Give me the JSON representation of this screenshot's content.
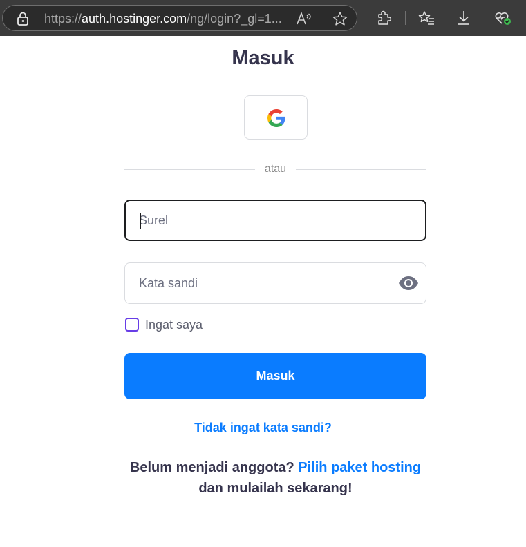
{
  "browser": {
    "url_scheme": "https://",
    "url_host": "auth.hostinger.com",
    "url_path": "/ng/login?_gl=1...",
    "toolbar_icons": [
      "lock-icon",
      "read-aloud-icon",
      "favorite-star-icon",
      "extensions-icon",
      "favorites-icon",
      "download-icon",
      "browser-essentials-icon"
    ]
  },
  "login": {
    "title": "Masuk",
    "google_icon": "google-icon",
    "divider_text": "atau",
    "email_placeholder": "Surel",
    "email_value": "",
    "password_placeholder": "Kata sandi",
    "password_value": "",
    "password_toggle_icon": "eye-icon",
    "remember_label": "Ingat saya",
    "remember_checked": false,
    "submit_label": "Masuk",
    "forgot_label": "Tidak ingat kata sandi?",
    "signup_prefix": "Belum menjadi anggota?",
    "signup_link": "Pilih paket hosting",
    "signup_suffix": "dan mulailah sekarang!"
  },
  "colors": {
    "accent": "#0a7cff",
    "heading": "#36344d",
    "checkbox_border": "#673de6",
    "chrome_bg": "#3b3b3b"
  }
}
